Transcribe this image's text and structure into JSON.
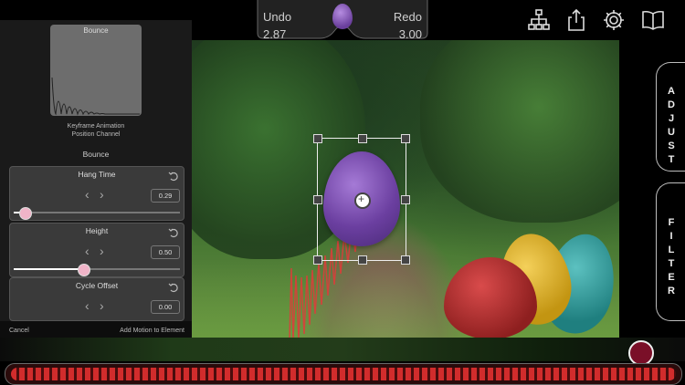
{
  "top": {
    "undo_label": "Undo",
    "undo_time": "2.87",
    "redo_label": "Redo",
    "redo_time": "3.00",
    "icons": [
      "hierarchy-icon",
      "share-icon",
      "gear-icon",
      "book-icon"
    ]
  },
  "left_panel": {
    "thumbnail_title": "Bounce",
    "kf_line1": "Keyframe Animation",
    "kf_line2": "Position Channel",
    "section_title": "Bounce",
    "params": [
      {
        "label": "Hang Time",
        "value": "0.29",
        "fraction": 0.05
      },
      {
        "label": "Height",
        "value": "0.50",
        "fraction": 0.42
      },
      {
        "label": "Cycle Offset",
        "value": "0.00",
        "fraction": 0.0
      }
    ],
    "cancel": "Cancel",
    "add_motion": "Add Motion to Element"
  },
  "side_tabs": [
    {
      "label": "ADJUST"
    },
    {
      "label": "FILTER"
    }
  ],
  "colors": {
    "record": "#7a0f28",
    "timeline": "#d12c2c"
  }
}
